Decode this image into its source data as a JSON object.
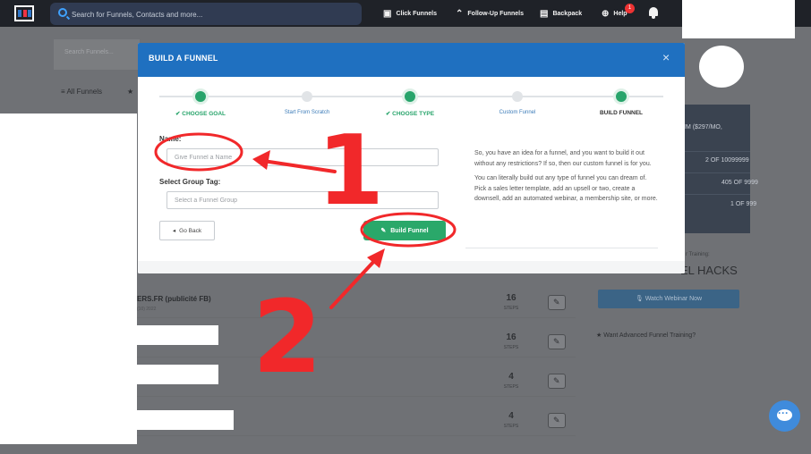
{
  "topbar": {
    "search_placeholder": "Search for Funnels, Contacts and more...",
    "nav": [
      {
        "label": "Click Funnels",
        "icon": "dashboard-icon"
      },
      {
        "label": "Follow-Up Funnels",
        "icon": "double-chevron-up-icon"
      },
      {
        "label": "Backpack",
        "icon": "backpack-icon"
      },
      {
        "label": "Help",
        "icon": "lifebuoy-icon"
      }
    ],
    "help_badge": "1"
  },
  "background": {
    "search_funnels_placeholder": "Search Funnels...",
    "all_funnels_label": "All Funnels",
    "rows": [
      {
        "title": "ERS.FR (publicité FB)",
        "subtitle": "(10) 2022",
        "steps": "16"
      },
      {
        "title": "",
        "subtitle": "",
        "steps": "16"
      },
      {
        "title": "",
        "subtitle": "",
        "steps": "4"
      },
      {
        "title": "",
        "subtitle": "",
        "steps": "4"
      }
    ],
    "steps_label": "STEPS",
    "plan_text": "IM ($297/MO,",
    "stats": [
      "2 OF 10099999",
      "405 OF 9999",
      "1 OF 999"
    ],
    "training_label": "r Training:",
    "hacks_title": "EL HACKS",
    "webinar_button": "Watch Webinar Now",
    "advanced_training": "Want Advanced Funnel Training?"
  },
  "modal": {
    "title": "BUILD A FUNNEL",
    "close": "×",
    "steps": [
      {
        "label": "CHOOSE GOAL",
        "state": "done",
        "check": "✔"
      },
      {
        "label": "Start From Scratch",
        "state": "todo",
        "check": ""
      },
      {
        "label": "CHOOSE TYPE",
        "state": "done",
        "check": "✔"
      },
      {
        "label": "Custom Funnel",
        "state": "todo",
        "check": ""
      },
      {
        "label": "BUILD FUNNEL",
        "state": "current",
        "check": ""
      }
    ],
    "name_label": "Name:",
    "name_placeholder": "Give Funnel a Name",
    "group_label": "Select Group Tag:",
    "group_placeholder": "Select a Funnel Group",
    "back_button": "Go Back",
    "build_button": "Build Funnel",
    "description": [
      "So, you have an idea for a funnel, and you want to build it out without any restrictions? If so, then our custom funnel is for you.",
      "You can literally build out any type of funnel you can dream of. Pick a sales letter template, add an upsell or two, create a downsell, add an automated webinar, a membership site, or more."
    ]
  },
  "annotations": {
    "number_1": "1",
    "number_2": "2",
    "color": "#f1282a"
  },
  "colors": {
    "accent_blue": "#1f70c0",
    "success_green": "#2aa86a"
  }
}
